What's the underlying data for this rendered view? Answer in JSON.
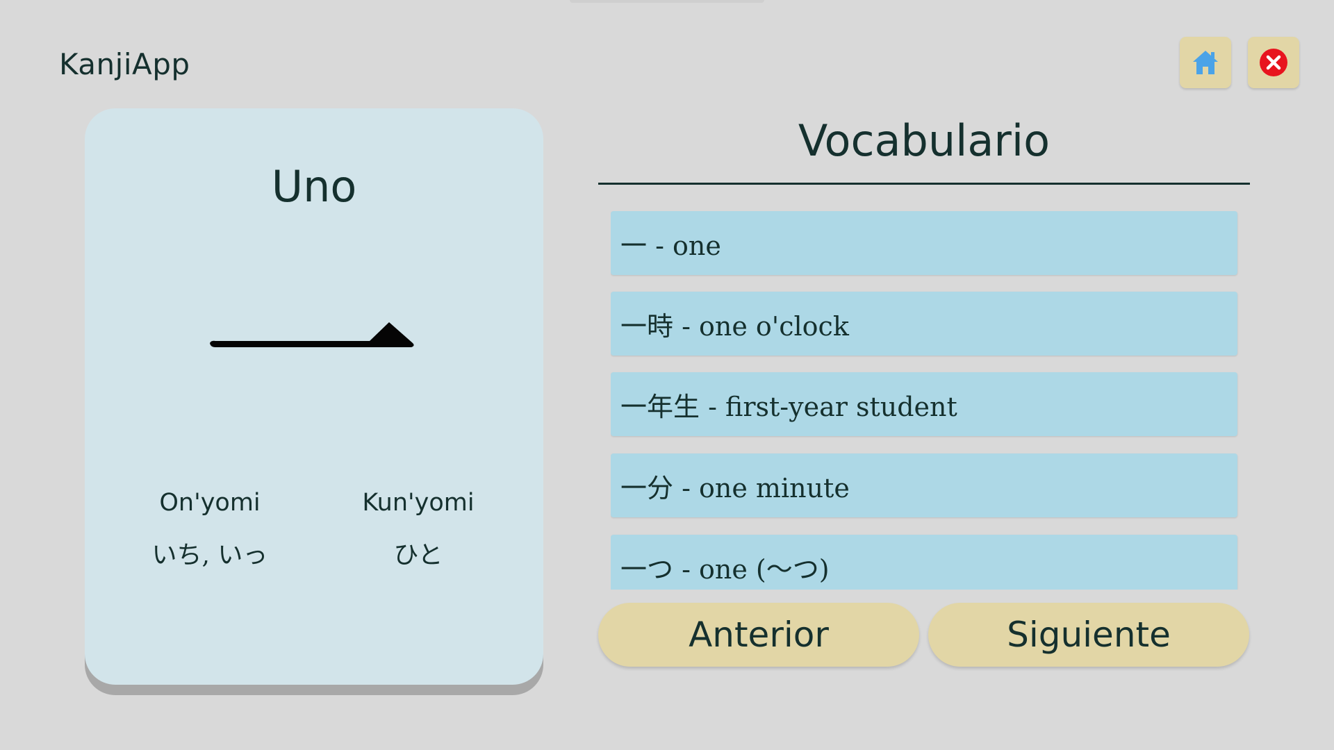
{
  "app": {
    "title": "KanjiApp"
  },
  "toolbar": {
    "home_icon": "home-icon",
    "close_icon": "close-icon",
    "home_color": "#4aa3e8",
    "close_color": "#e8141e"
  },
  "kanji_card": {
    "meaning": "Uno",
    "kanji": "一",
    "onyomi_label": "On'yomi",
    "onyomi_value": "いち, いっ",
    "kunyomi_label": "Kun'yomi",
    "kunyomi_value": "ひと"
  },
  "vocabulary": {
    "title": "Vocabulario",
    "items": [
      {
        "text": "一 - one"
      },
      {
        "text": "一時 - one o'clock"
      },
      {
        "text": "一年生 - first-year student"
      },
      {
        "text": "一分 - one minute"
      },
      {
        "text": "一つ - one (～つ)"
      }
    ]
  },
  "navigation": {
    "previous_label": "Anterior",
    "next_label": "Siguiente"
  },
  "colors": {
    "background": "#d9d9d9",
    "card": "#d2e4ea",
    "vocab_item": "#add8e6",
    "button": "#e2d6a6",
    "text": "#15302e"
  }
}
